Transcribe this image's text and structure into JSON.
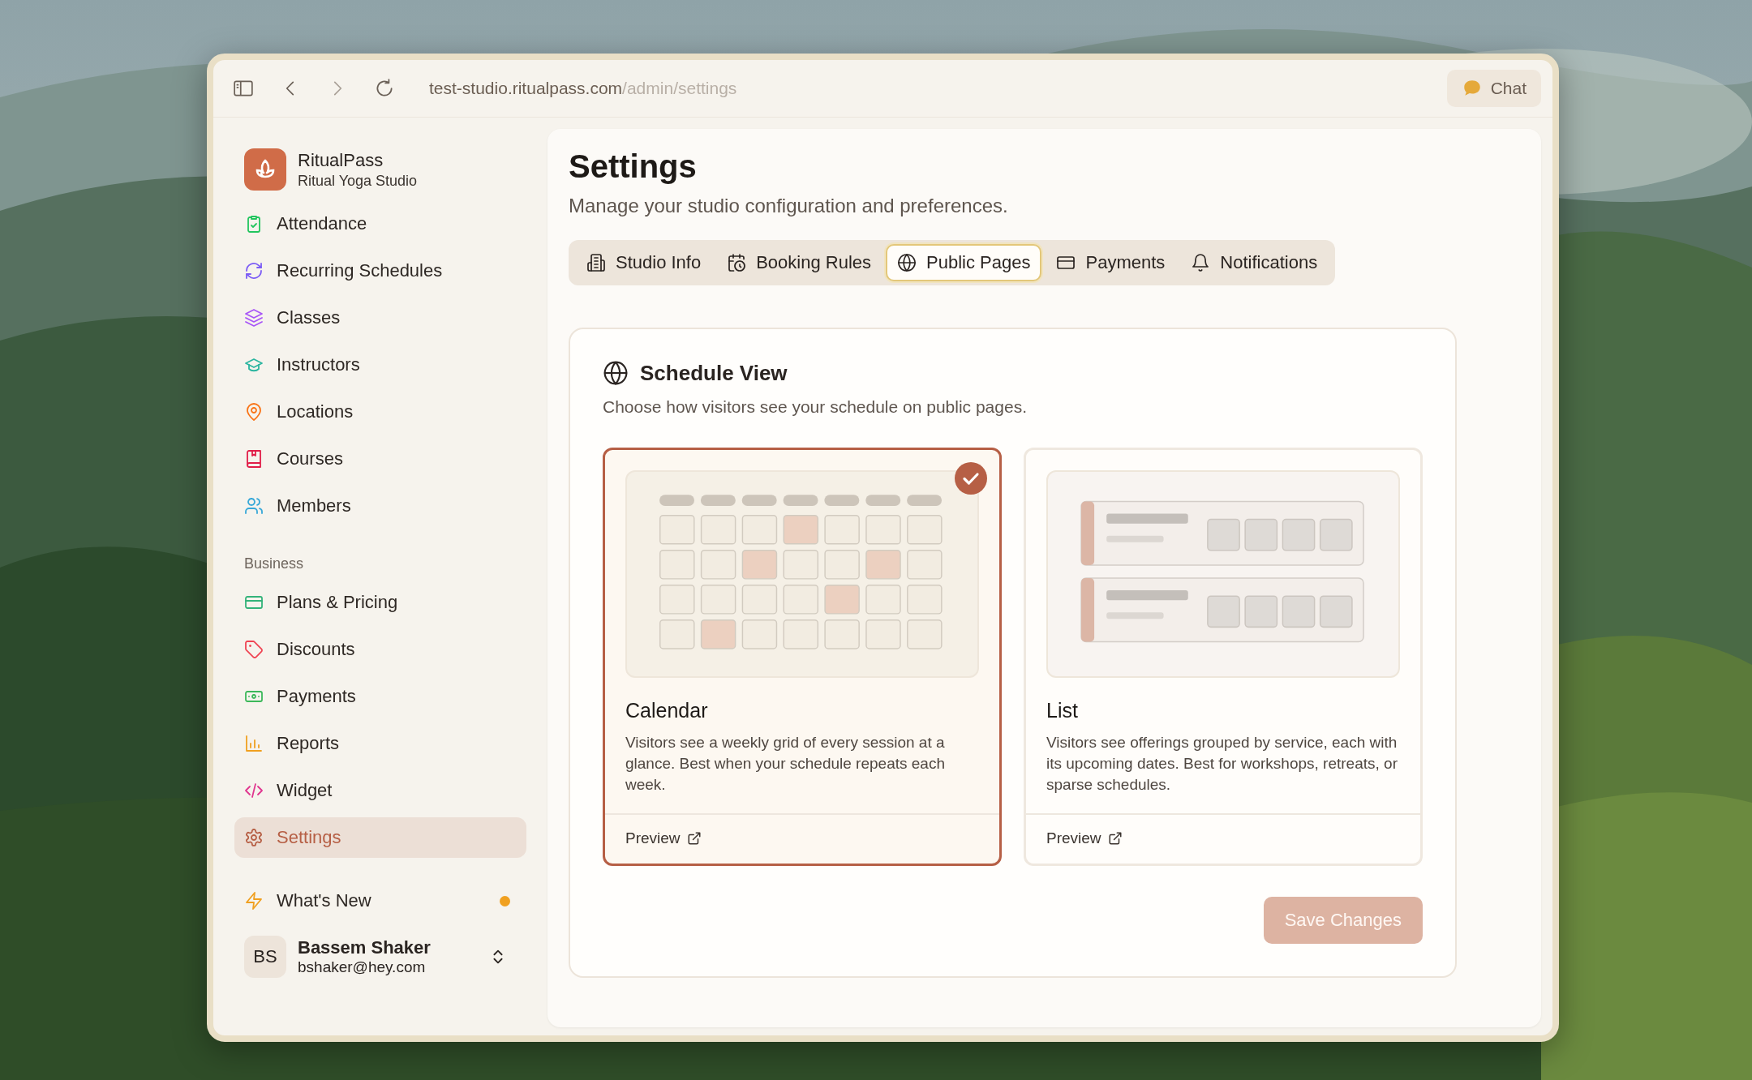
{
  "browser": {
    "url_host": "test-studio.ritualpass.com",
    "url_path": "/admin/settings",
    "chat_button": "Chat"
  },
  "sidebar": {
    "brand": {
      "name": "RitualPass",
      "studio": "Ritual Yoga Studio"
    },
    "items": [
      {
        "label": "Attendance",
        "color": "#22c55e",
        "selected": false
      },
      {
        "label": "Recurring Schedules",
        "color": "#7c5cf5",
        "selected": false
      },
      {
        "label": "Classes",
        "color": "#a855f7",
        "selected": false
      },
      {
        "label": "Instructors",
        "color": "#2bb5a0",
        "selected": false
      },
      {
        "label": "Locations",
        "color": "#f97316",
        "selected": false
      },
      {
        "label": "Courses",
        "color": "#e11d48",
        "selected": false
      },
      {
        "label": "Members",
        "color": "#38a8d8",
        "selected": false
      }
    ],
    "section_label": "Business",
    "business_items": [
      {
        "label": "Plans & Pricing",
        "color": "#34b37a",
        "selected": false
      },
      {
        "label": "Discounts",
        "color": "#ef4453",
        "selected": false
      },
      {
        "label": "Payments",
        "color": "#3cb85a",
        "selected": false
      },
      {
        "label": "Reports",
        "color": "#f0a020",
        "selected": false
      },
      {
        "label": "Widget",
        "color": "#e0368f",
        "selected": false
      },
      {
        "label": "Settings",
        "color": "#b65f45",
        "selected": true
      }
    ],
    "whats_new": {
      "label": "What's New",
      "unread": true
    },
    "user": {
      "initials": "BS",
      "name": "Bassem Shaker",
      "email": "bshaker@hey.com"
    }
  },
  "page": {
    "title": "Settings",
    "subtitle": "Manage your studio configuration and preferences.",
    "tabs": [
      {
        "label": "Studio Info",
        "selected": false
      },
      {
        "label": "Booking Rules",
        "selected": false
      },
      {
        "label": "Public Pages",
        "selected": true
      },
      {
        "label": "Payments",
        "selected": false
      },
      {
        "label": "Notifications",
        "selected": false
      }
    ],
    "section": {
      "title": "Schedule View",
      "description": "Choose how visitors see your schedule on public pages.",
      "options": [
        {
          "kind": "calendar",
          "title": "Calendar",
          "description": "Visitors see a weekly grid of every session at a glance. Best when your schedule repeats each week.",
          "preview_link": "Preview",
          "selected": true
        },
        {
          "kind": "list",
          "title": "List",
          "description": "Visitors see offerings grouped by service, each with its upcoming dates. Best for workshops, retreats, or sparse schedules.",
          "preview_link": "Preview",
          "selected": false
        }
      ]
    },
    "save_button": {
      "label": "Save Changes",
      "disabled": true
    }
  }
}
